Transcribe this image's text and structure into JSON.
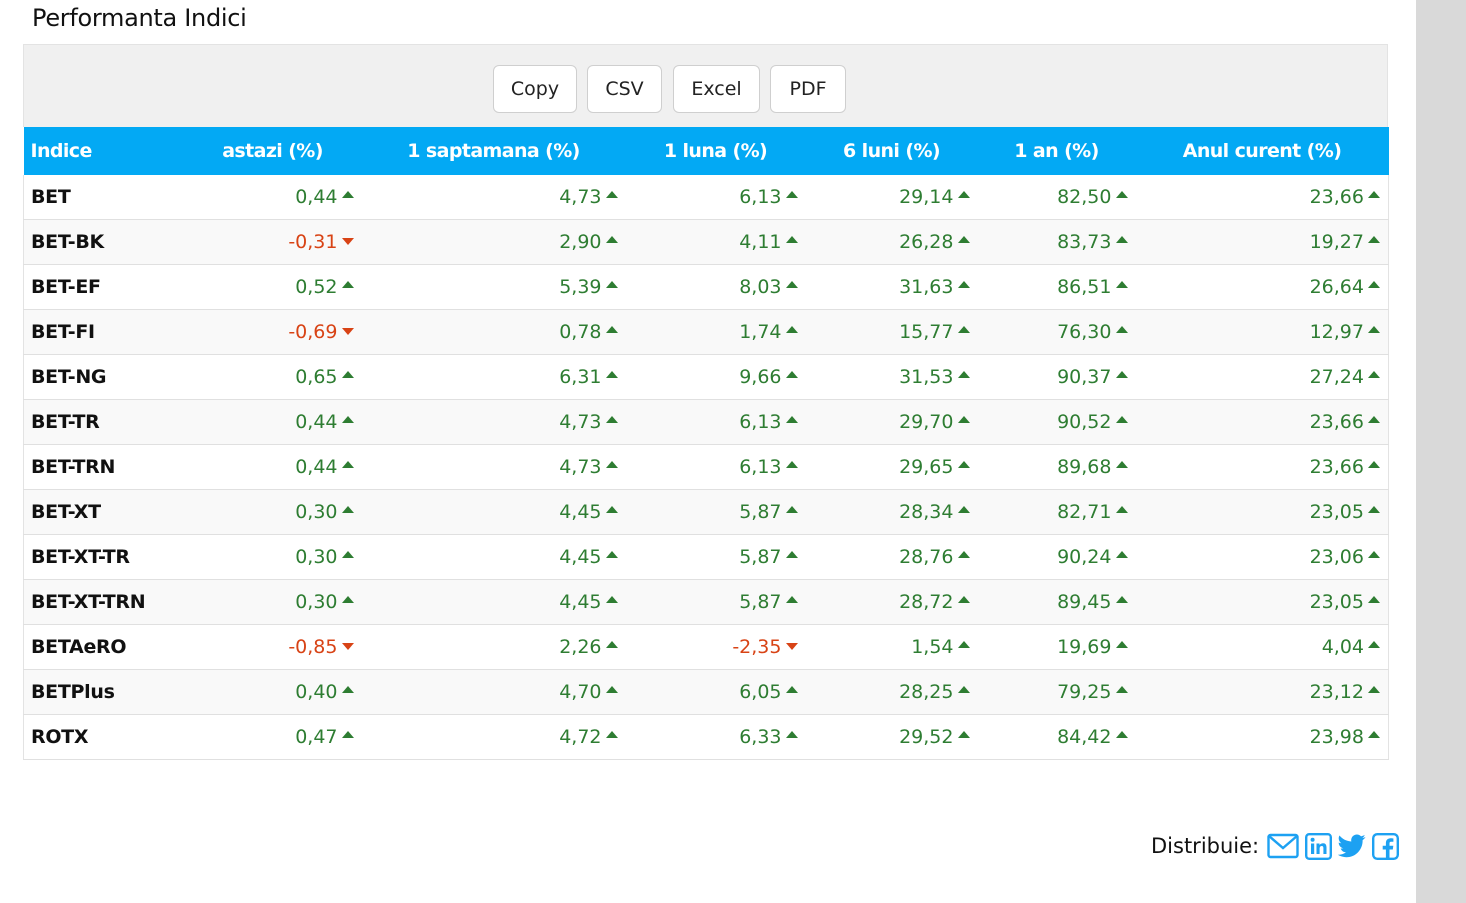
{
  "title": "Performanta Indici",
  "buttons": [
    "Copy",
    "CSV",
    "Excel",
    "PDF"
  ],
  "columns": [
    "Indice",
    "astazi (%)",
    "1 saptamana (%)",
    "1 luna (%)",
    "6 luni (%)",
    "1 an (%)",
    "Anul curent (%)"
  ],
  "rows": [
    {
      "name": "BET",
      "values": [
        "0,44",
        "4,73",
        "6,13",
        "29,14",
        "82,50",
        "23,66"
      ],
      "dirs": [
        "up",
        "up",
        "up",
        "up",
        "up",
        "up"
      ]
    },
    {
      "name": "BET-BK",
      "values": [
        "-0,31",
        "2,90",
        "4,11",
        "26,28",
        "83,73",
        "19,27"
      ],
      "dirs": [
        "down",
        "up",
        "up",
        "up",
        "up",
        "up"
      ]
    },
    {
      "name": "BET-EF",
      "values": [
        "0,52",
        "5,39",
        "8,03",
        "31,63",
        "86,51",
        "26,64"
      ],
      "dirs": [
        "up",
        "up",
        "up",
        "up",
        "up",
        "up"
      ]
    },
    {
      "name": "BET-FI",
      "values": [
        "-0,69",
        "0,78",
        "1,74",
        "15,77",
        "76,30",
        "12,97"
      ],
      "dirs": [
        "down",
        "up",
        "up",
        "up",
        "up",
        "up"
      ]
    },
    {
      "name": "BET-NG",
      "values": [
        "0,65",
        "6,31",
        "9,66",
        "31,53",
        "90,37",
        "27,24"
      ],
      "dirs": [
        "up",
        "up",
        "up",
        "up",
        "up",
        "up"
      ]
    },
    {
      "name": "BET-TR",
      "values": [
        "0,44",
        "4,73",
        "6,13",
        "29,70",
        "90,52",
        "23,66"
      ],
      "dirs": [
        "up",
        "up",
        "up",
        "up",
        "up",
        "up"
      ]
    },
    {
      "name": "BET-TRN",
      "values": [
        "0,44",
        "4,73",
        "6,13",
        "29,65",
        "89,68",
        "23,66"
      ],
      "dirs": [
        "up",
        "up",
        "up",
        "up",
        "up",
        "up"
      ]
    },
    {
      "name": "BET-XT",
      "values": [
        "0,30",
        "4,45",
        "5,87",
        "28,34",
        "82,71",
        "23,05"
      ],
      "dirs": [
        "up",
        "up",
        "up",
        "up",
        "up",
        "up"
      ]
    },
    {
      "name": "BET-XT-TR",
      "values": [
        "0,30",
        "4,45",
        "5,87",
        "28,76",
        "90,24",
        "23,06"
      ],
      "dirs": [
        "up",
        "up",
        "up",
        "up",
        "up",
        "up"
      ]
    },
    {
      "name": "BET-XT-TRN",
      "values": [
        "0,30",
        "4,45",
        "5,87",
        "28,72",
        "89,45",
        "23,05"
      ],
      "dirs": [
        "up",
        "up",
        "up",
        "up",
        "up",
        "up"
      ]
    },
    {
      "name": "BETAeRO",
      "values": [
        "-0,85",
        "2,26",
        "-2,35",
        "1,54",
        "19,69",
        "4,04"
      ],
      "dirs": [
        "down",
        "up",
        "down",
        "up",
        "up",
        "up"
      ]
    },
    {
      "name": "BETPlus",
      "values": [
        "0,40",
        "4,70",
        "6,05",
        "28,25",
        "79,25",
        "23,12"
      ],
      "dirs": [
        "up",
        "up",
        "up",
        "up",
        "up",
        "up"
      ]
    },
    {
      "name": "ROTX",
      "values": [
        "0,47",
        "4,72",
        "6,33",
        "29,52",
        "84,42",
        "23,98"
      ],
      "dirs": [
        "up",
        "up",
        "up",
        "up",
        "up",
        "up"
      ]
    }
  ],
  "share": {
    "label": "Distribuie:",
    "icons": [
      "email-icon",
      "linkedin-icon",
      "twitter-icon",
      "facebook-icon"
    ]
  },
  "colors": {
    "header": "#03a9f4",
    "positive": "#2e7d32",
    "negative": "#d84315",
    "share": "#1da1f2"
  }
}
